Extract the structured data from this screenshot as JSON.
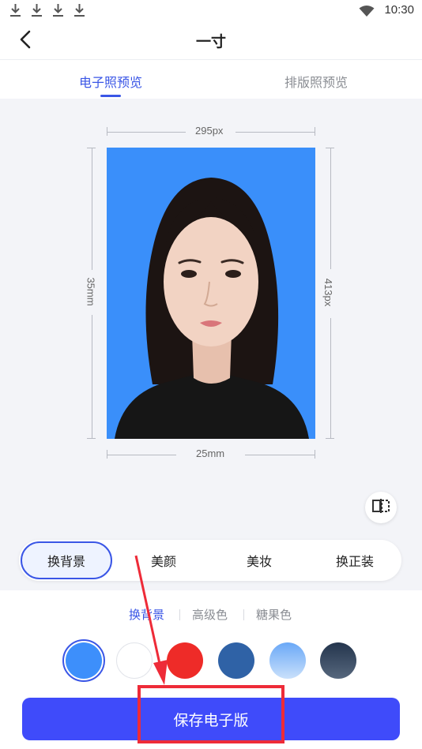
{
  "status_bar": {
    "time": "10:30",
    "download_icons": [
      "download-icon",
      "download-icon",
      "download-icon",
      "download-icon"
    ],
    "wifi_icon": "wifi-icon"
  },
  "header": {
    "back_icon": "chevron-left-icon",
    "title": "一寸"
  },
  "tabs": [
    {
      "label": "电子照预览",
      "active": true
    },
    {
      "label": "排版照预览",
      "active": false
    }
  ],
  "preview": {
    "width_px_label": "295px",
    "height_px_label": "413px",
    "width_mm_label": "25mm",
    "height_mm_label": "35mm",
    "photo_background": "#3a8ffa",
    "compare_icon": "compare-icon"
  },
  "functions": [
    {
      "label": "换背景",
      "active": true
    },
    {
      "label": "美颜",
      "active": false
    },
    {
      "label": "美妆",
      "active": false
    },
    {
      "label": "换正装",
      "active": false
    }
  ],
  "subtabs": [
    {
      "label": "换背景",
      "active": true
    },
    {
      "label": "高级色",
      "active": false
    },
    {
      "label": "糖果色",
      "active": false
    }
  ],
  "swatches": [
    {
      "name": "blue",
      "color": "#3d8ffb",
      "selected": true
    },
    {
      "name": "white",
      "color": "#ffffff",
      "selected": false
    },
    {
      "name": "red",
      "color": "#ee2b28",
      "selected": false
    },
    {
      "name": "dark-blue",
      "color": "#2f62a6",
      "selected": false
    },
    {
      "name": "gradient-blue",
      "color": "#8ebdf8",
      "selected": false
    },
    {
      "name": "gradient-gray",
      "color": "#3b4c63",
      "selected": false
    }
  ],
  "actions": {
    "save_label": "保存电子版"
  },
  "colors": {
    "accent": "#3a56e6",
    "save_button": "#3f4bfa",
    "annotation": "#ee2b38"
  }
}
